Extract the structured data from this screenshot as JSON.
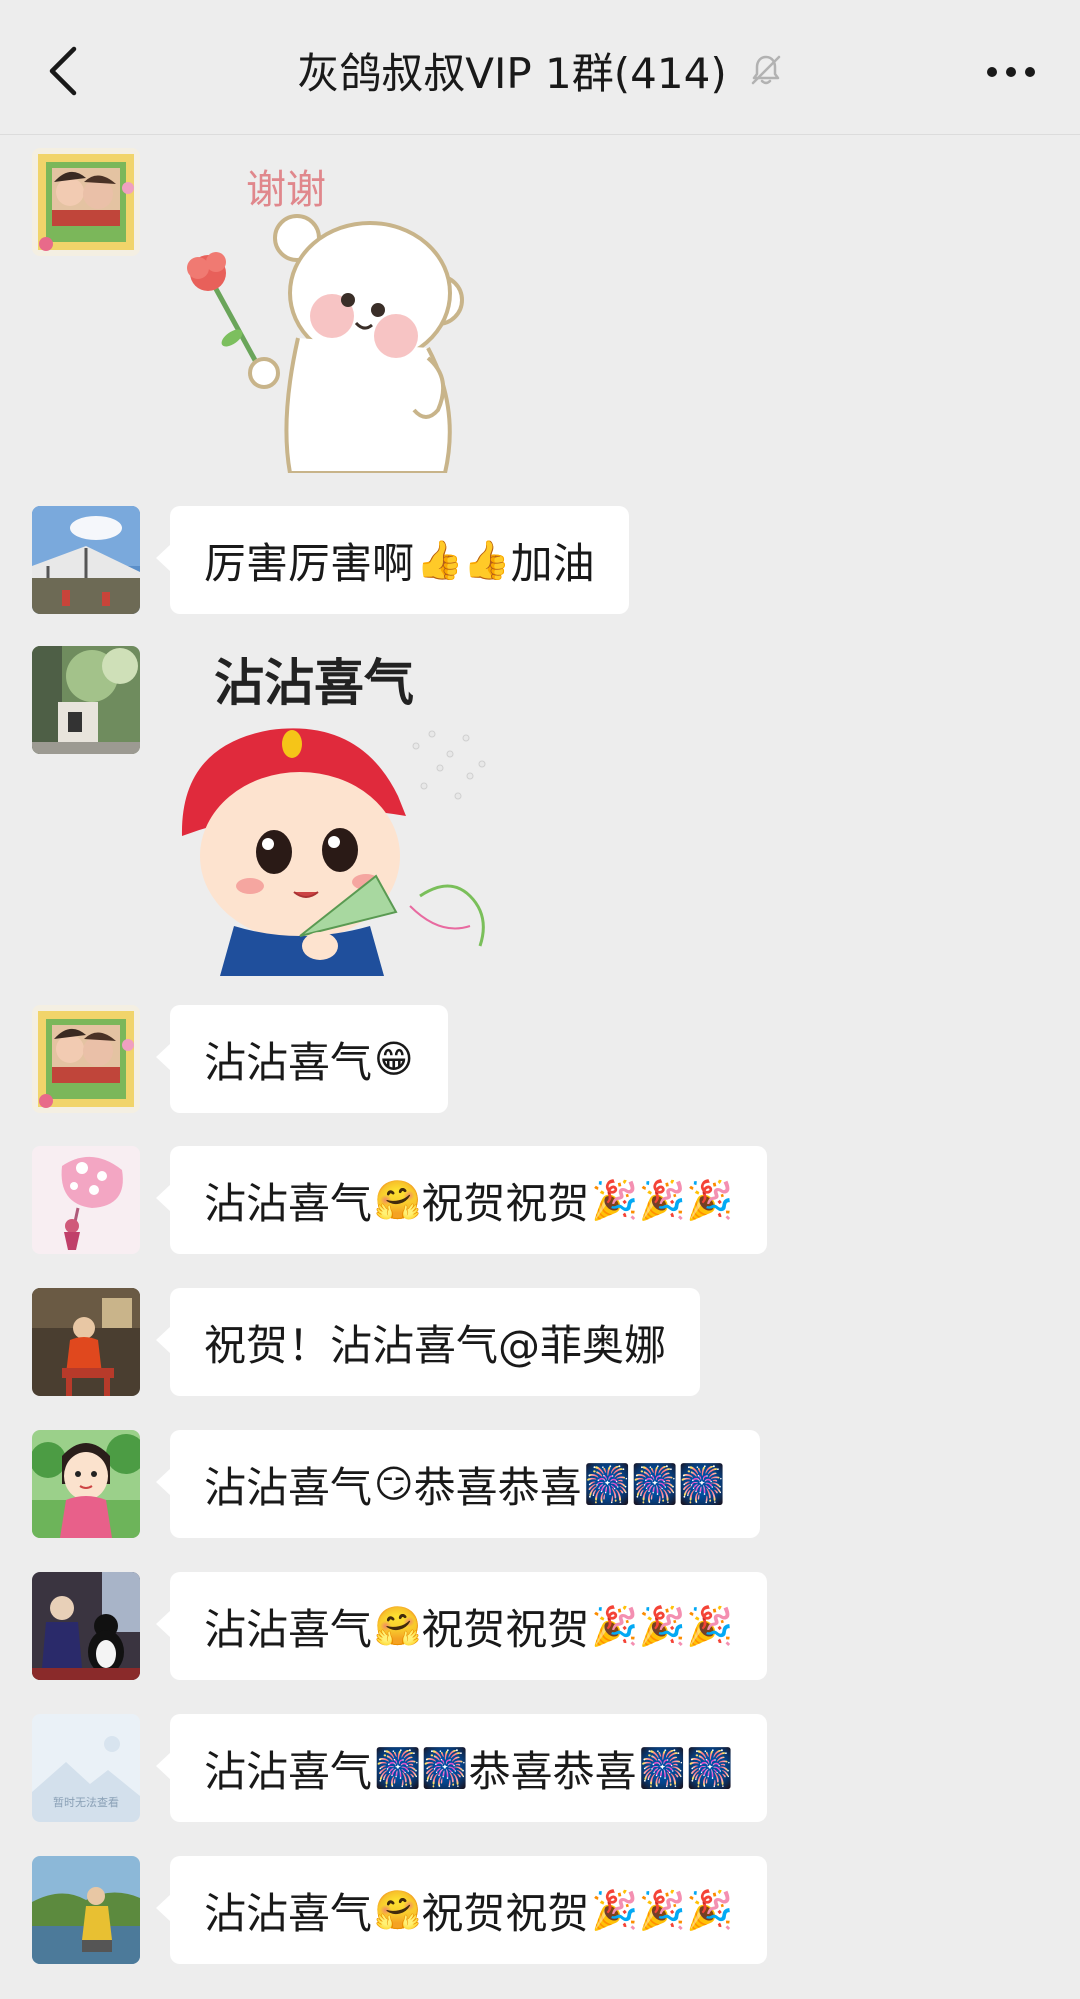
{
  "header": {
    "title": "灰鸽叔叔VIP 1群(414)",
    "back_icon": "chevron-left-icon",
    "mute_icon": "bell-muted-icon",
    "more_icon": "more-dots-icon"
  },
  "stickers": {
    "thanks_text": "谢谢",
    "blessing_text": "沾沾喜气"
  },
  "messages": [
    {
      "text": "厉害厉害啊",
      "emoji_a": "👍👍",
      "tail": "加油"
    },
    {
      "text": "沾沾喜气",
      "emoji_a": "😁"
    },
    {
      "text": "沾沾喜气",
      "emoji_a": "🤗",
      "middle": " 祝贺祝贺",
      "emoji_b": "🎉🎉🎉"
    },
    {
      "text": "祝贺！沾沾喜气@菲奥娜"
    },
    {
      "text": "沾沾喜气",
      "emoji_a": "😏",
      "middle": "恭喜恭喜",
      "emoji_b": "🎆🎆🎆"
    },
    {
      "text": "沾沾喜气",
      "emoji_a": "🤗",
      "middle": " 祝贺祝贺",
      "emoji_b": "🎉🎉🎉"
    },
    {
      "text": "沾沾喜气",
      "emoji_a": "🎆🎆",
      "middle": "恭喜恭喜",
      "emoji_b": "🎆🎆"
    },
    {
      "text": "沾沾喜气",
      "emoji_a": "🤗",
      "middle": " 祝贺祝贺",
      "emoji_b": "🎉🎉🎉"
    }
  ],
  "avatar_placeholder_text": "暂时无法查看",
  "colors": {
    "background": "#ededed",
    "bubble": "#ffffff",
    "text": "#191919"
  }
}
